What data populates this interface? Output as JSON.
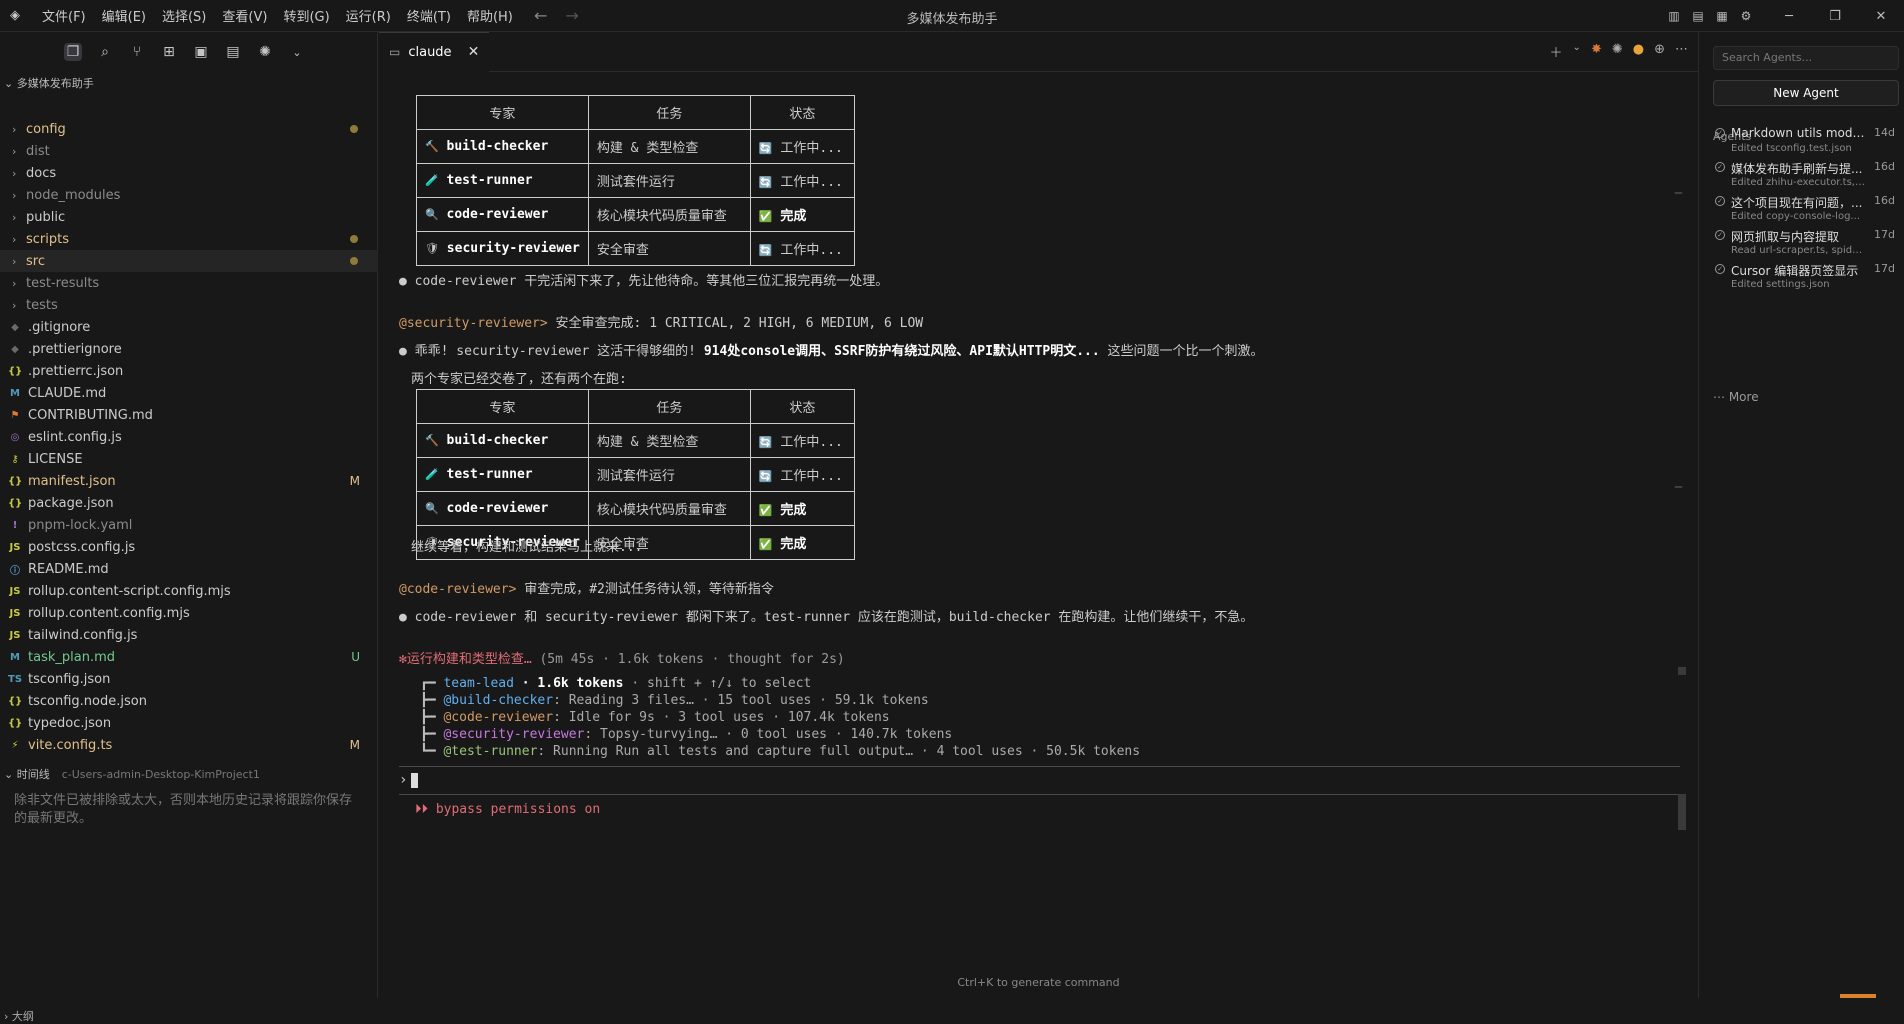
{
  "titlebar": {
    "menus": [
      "文件(F)",
      "编辑(E)",
      "选择(S)",
      "查看(V)",
      "转到(G)",
      "运行(R)",
      "终端(T)",
      "帮助(H)"
    ],
    "title": "多媒体发布助手"
  },
  "explorer": {
    "project": "多媒体发布助手",
    "items": [
      {
        "name": "config",
        "type": "folder",
        "color": "#e2c08d",
        "dot": true
      },
      {
        "name": "dist",
        "type": "folder",
        "color": "#8b8b8b"
      },
      {
        "name": "docs",
        "type": "folder",
        "color": "#cccccc"
      },
      {
        "name": "node_modules",
        "type": "folder",
        "color": "#8b8b8b"
      },
      {
        "name": "public",
        "type": "folder",
        "color": "#cccccc"
      },
      {
        "name": "scripts",
        "type": "folder",
        "color": "#e2c08d",
        "dot": true
      },
      {
        "name": "src",
        "type": "folder",
        "color": "#e2c08d",
        "dot": true,
        "active": true
      },
      {
        "name": "test-results",
        "type": "folder",
        "color": "#8b8b8b"
      },
      {
        "name": "tests",
        "type": "folder",
        "color": "#8b8b8b"
      },
      {
        "name": ".gitignore",
        "type": "file",
        "icon": "◆",
        "icon_color": "#6a6a6a",
        "color": "#cccccc"
      },
      {
        "name": ".prettierignore",
        "type": "file",
        "icon": "◆",
        "icon_color": "#6a6a6a",
        "color": "#cccccc"
      },
      {
        "name": ".prettierrc.json",
        "type": "file",
        "icon": "{}",
        "icon_color": "#cbcb41",
        "color": "#cccccc"
      },
      {
        "name": "CLAUDE.md",
        "type": "file",
        "icon": "M",
        "icon_color": "#519aba",
        "color": "#cccccc"
      },
      {
        "name": "CONTRIBUTING.md",
        "type": "file",
        "icon": "⚑",
        "icon_color": "#e37933",
        "color": "#cccccc"
      },
      {
        "name": "eslint.config.js",
        "type": "file",
        "icon": "◎",
        "icon_color": "#a074c4",
        "color": "#cccccc"
      },
      {
        "name": "LICENSE",
        "type": "file",
        "icon": "⚷",
        "icon_color": "#cbcb41",
        "color": "#cccccc"
      },
      {
        "name": "manifest.json",
        "type": "file",
        "icon": "{}",
        "icon_color": "#cbcb41",
        "color": "#e2c08d",
        "badge": "M"
      },
      {
        "name": "package.json",
        "type": "file",
        "icon": "{}",
        "icon_color": "#cbcb41",
        "color": "#cccccc"
      },
      {
        "name": "pnpm-lock.yaml",
        "type": "file",
        "icon": "!",
        "icon_color": "#a074c4",
        "color": "#8b8b8b"
      },
      {
        "name": "postcss.config.js",
        "type": "file",
        "icon": "JS",
        "icon_color": "#cbcb41",
        "color": "#cccccc"
      },
      {
        "name": "README.md",
        "type": "file",
        "icon": "ⓘ",
        "icon_color": "#519aba",
        "color": "#cccccc"
      },
      {
        "name": "rollup.content-script.config.mjs",
        "type": "file",
        "icon": "JS",
        "icon_color": "#cbcb41",
        "color": "#cccccc"
      },
      {
        "name": "rollup.content.config.mjs",
        "type": "file",
        "icon": "JS",
        "icon_color": "#cbcb41",
        "color": "#cccccc"
      },
      {
        "name": "tailwind.config.js",
        "type": "file",
        "icon": "JS",
        "icon_color": "#cbcb41",
        "color": "#cccccc"
      },
      {
        "name": "task_plan.md",
        "type": "file",
        "icon": "M",
        "icon_color": "#519aba",
        "color": "#73c991",
        "badge": "U"
      },
      {
        "name": "tsconfig.json",
        "type": "file",
        "icon": "TS",
        "icon_color": "#519aba",
        "color": "#cccccc"
      },
      {
        "name": "tsconfig.node.json",
        "type": "file",
        "icon": "{}",
        "icon_color": "#cbcb41",
        "color": "#cccccc"
      },
      {
        "name": "typedoc.json",
        "type": "file",
        "icon": "{}",
        "icon_color": "#cbcb41",
        "color": "#cccccc"
      },
      {
        "name": "vite.config.ts",
        "type": "file",
        "icon": "⚡",
        "icon_color": "#cbcb41",
        "color": "#e2c08d",
        "badge": "M"
      }
    ]
  },
  "timeline": {
    "title": "时间线",
    "subtitle": "c-Users-admin-Desktop-KimProject1",
    "message": "除非文件已被排除或太大，否则本地历史记录将跟踪你保存的最新更改。"
  },
  "outline": {
    "title": "大纲"
  },
  "tab": {
    "label": "claude"
  },
  "terminal": {
    "table_headers": [
      "专家",
      "任务",
      "状态"
    ],
    "table1": [
      {
        "icon": "🔨",
        "name": "build-checker",
        "task": "构建 & 类型检查",
        "status_icon": "🔄",
        "status": "工作中...",
        "bold": false
      },
      {
        "icon": "🧪",
        "name": "test-runner",
        "task": "测试套件运行",
        "status_icon": "🔄",
        "status": "工作中...",
        "bold": false
      },
      {
        "icon": "🔍",
        "name": "code-reviewer",
        "task": "核心模块代码质量审查",
        "status_icon": "✅",
        "status": "完成",
        "bold": true
      },
      {
        "icon": "🛡",
        "name": "security-reviewer",
        "task": "安全审查",
        "status_icon": "🔄",
        "status": "工作中...",
        "bold": false
      }
    ],
    "line1": "● code-reviewer 干完活闲下来了，先让他待命。等其他三位汇报完再统一处理。",
    "sec_tag": "@security-reviewer>",
    "sec_msg": " 安全审查完成: 1 CRITICAL, 2 HIGH, 6 MEDIUM, 6 LOW",
    "line2_pre": "● 乖乖! security-reviewer 这活干得够细的! ",
    "line2_bold": "914处console调用、SSRF防护有绕过风险、API默认HTTP明文...",
    "line2_post": " 这些问题一个比一个刺激。",
    "line3": "两个专家已经交卷了，还有两个在跑:",
    "table2": [
      {
        "icon": "🔨",
        "name": "build-checker",
        "task": "构建 & 类型检查",
        "status_icon": "🔄",
        "status": "工作中...",
        "bold": false
      },
      {
        "icon": "🧪",
        "name": "test-runner",
        "task": "测试套件运行",
        "status_icon": "🔄",
        "status": "工作中...",
        "bold": false
      },
      {
        "icon": "🔍",
        "name": "code-reviewer",
        "task": "核心模块代码质量审查",
        "status_icon": "✅",
        "status": "完成",
        "bold": true
      },
      {
        "icon": "🛡",
        "name": "security-reviewer",
        "task": "安全审查",
        "status_icon": "✅",
        "status": "完成",
        "bold": true
      }
    ],
    "line4": "继续等着，构建和测试结果马上就来...",
    "code_tag": "@code-reviewer>",
    "code_msg": " 审查完成，#2测试任务待认领，等待新指令",
    "line5": "● code-reviewer 和 security-reviewer 都闲下来了。test-runner 应该在跑测试，build-checker 在跑构建。让他们继续干，不急。",
    "status_star": "✻",
    "status_label": "运行构建和类型检查…",
    "status_meta": " (5m 45s · 1.6k tokens · thought for 2s)",
    "team": [
      {
        "prefix": "┏━ ",
        "name": "team-lead",
        "color": "#61afef",
        "info_bold": " · 1.6k tokens",
        "info": " · shift + ↑/↓ to select"
      },
      {
        "prefix": "┣━ ",
        "name": "@build-checker",
        "color": "#61afef",
        "info_bold": "",
        "info": ": Reading 3 files… · 15 tool uses · 59.1k tokens"
      },
      {
        "prefix": "┣━ ",
        "name": "@code-reviewer",
        "color": "#d19a66",
        "info_bold": "",
        "info": ": Idle for 9s · 3 tool uses · 107.4k tokens"
      },
      {
        "prefix": "┣━ ",
        "name": "@security-reviewer",
        "color": "#c678dd",
        "info_bold": "",
        "info": ": Topsy-turvying… · 0 tool uses · 140.7k tokens"
      },
      {
        "prefix": "┗━ ",
        "name": "@test-runner",
        "color": "#98c379",
        "info_bold": "",
        "info": ": Running Run all tests and capture full output… · 4 tool uses · 50.5k tokens"
      }
    ],
    "prompt": "›",
    "bypass": "⏵⏵ bypass permissions on",
    "hint": "Ctrl+K to generate command"
  },
  "agents_panel": {
    "search_placeholder": "Search Agents...",
    "new_agent": "New Agent",
    "label": "Agents",
    "items": [
      {
        "title": "Markdown utils module...",
        "sub": "Edited tsconfig.test.json",
        "age": "14d"
      },
      {
        "title": "媒体发布助手刷新与提...",
        "sub": "Edited zhihu-executor.ts, ...",
        "age": "16d"
      },
      {
        "title": "这个项目现在有问题，...",
        "sub": "Edited copy-console-log...",
        "age": "16d"
      },
      {
        "title": "网页抓取与内容提取",
        "sub": "Read url-scraper.ts, spider...",
        "age": "17d"
      },
      {
        "title": "Cursor 编辑器页签显示",
        "sub": "Edited settings.json",
        "age": "17d"
      }
    ],
    "more": "More"
  }
}
